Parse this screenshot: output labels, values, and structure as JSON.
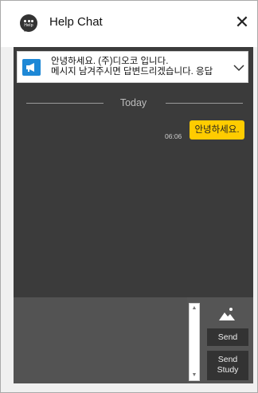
{
  "window": {
    "title": "Help Chat",
    "app_icon_text": "Help",
    "close_glyph": "✕"
  },
  "notice": {
    "line1": "안녕하세요. (주)디오코 입니다.",
    "line2": "메시지 남겨주시면 답변드리겠습니다. 응답",
    "icon": "megaphone-icon",
    "expand_icon": "chevron-down-icon"
  },
  "chat": {
    "date_divider": "Today",
    "messages": [
      {
        "time": "06:06",
        "text": "안녕하세요."
      }
    ]
  },
  "composer": {
    "image_icon": "image-icon",
    "send_label": "Send",
    "send_study_label_line1": "Send",
    "send_study_label_line2": "Study",
    "scroll_up_glyph": "▲",
    "scroll_down_glyph": "▼"
  },
  "colors": {
    "chat_background": "#3b3b3b",
    "composer_background": "#555555",
    "bubble": "#ffcc00",
    "button": "#333333",
    "megaphone": "#1e88d6"
  }
}
